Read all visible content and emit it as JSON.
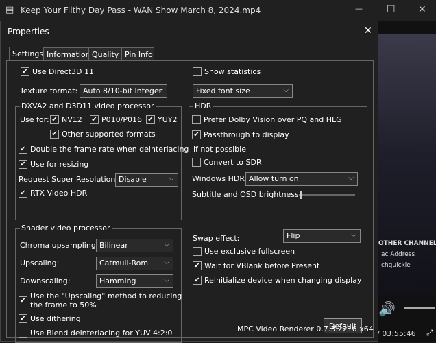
{
  "window": {
    "title": "Keep Your Filthy Day Pass - WAN Show March 8, 2024.mp4",
    "minimize": "—",
    "maximize": "☐",
    "close": "✕"
  },
  "video": {
    "line1": "OTHER CHANNELS",
    "line2": "ac Address",
    "line3": "chquickie",
    "time": "/ 03:55:46"
  },
  "dialog": {
    "title": "Properties",
    "close": "✕"
  },
  "tabs": [
    "Settings",
    "Information",
    "Quality",
    "Pin Info"
  ],
  "settings": {
    "use_d3d11": {
      "label": "Use Direct3D 11",
      "checked": true
    },
    "texture_format": {
      "label": "Texture format:",
      "value": "Auto 8/10-bit Integer"
    },
    "dxva_group": {
      "title": "DXVA2 and D3D11 video processor",
      "use_for": "Use for:",
      "nv12": "NV12",
      "p010": "P010/P016",
      "yuy2": "YUY2",
      "other": "Other supported formats",
      "double_frame": "Double the frame rate when deinterlacing",
      "resizing": "Use for resizing",
      "super_res": "Request Super Resolution:",
      "super_res_value": "Disable",
      "rtx_hdr": "RTX Video HDR"
    },
    "shader_group": {
      "title": "Shader video processor",
      "chroma": "Chroma upsampling:",
      "chroma_value": "Bilinear",
      "upscaling": "Upscaling:",
      "upscaling_value": "Catmull-Rom",
      "downscaling": "Downscaling:",
      "downscaling_value": "Hamming",
      "upscaling_method_1": "Use the \"Upscaling\" method to reducing",
      "upscaling_method_2": "the frame to 50%",
      "dithering": "Use dithering",
      "blend": "Use Blend deinterlacing for YUV 4:2:0"
    },
    "show_statistics": "Show statistics",
    "font_size": "Fixed font size",
    "hdr_group": {
      "title": "HDR",
      "dolby": "Prefer Dolby Vision over PQ and HLG",
      "passthrough": "Passthrough to display",
      "if_not": "if not possible",
      "convert_sdr": "Convert to SDR",
      "windows_hdr": "Windows HDR:",
      "windows_hdr_value": "Allow turn on",
      "subtitle_brightness": "Subtitle and OSD brightness:"
    },
    "swap_effect": "Swap effect:",
    "swap_value": "Flip",
    "exclusive_fullscreen": "Use exclusive fullscreen",
    "vblank": "Wait for VBlank before Present",
    "reinit": "Reinitialize device when changing display",
    "default_button": "Default",
    "footer": "MPC Video Renderer 0.7.3.2210 x64"
  }
}
